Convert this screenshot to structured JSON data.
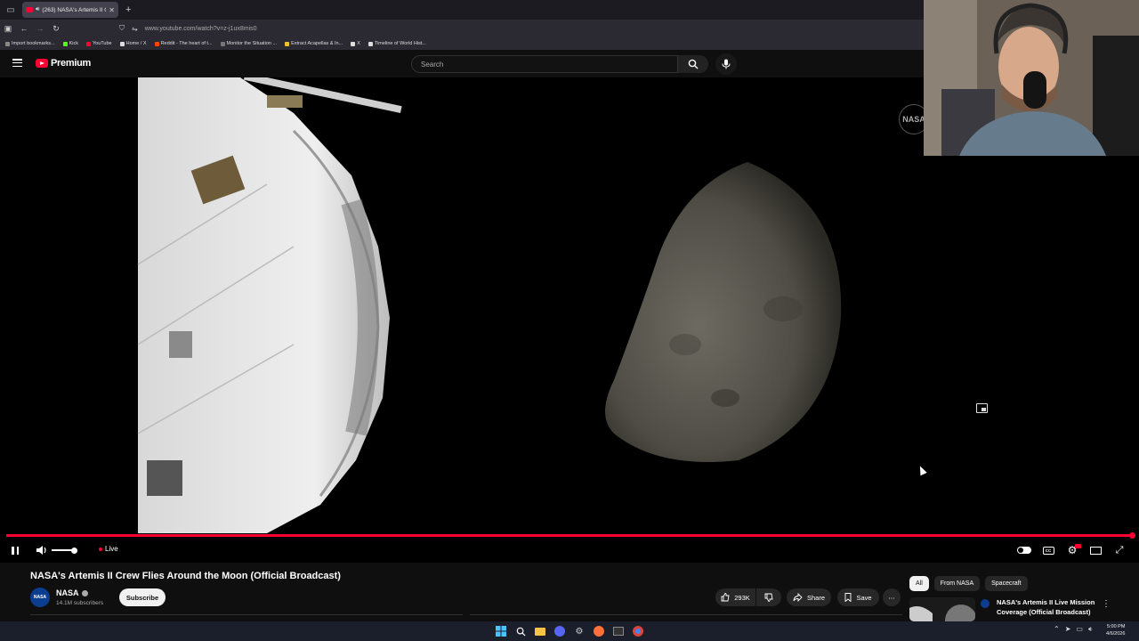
{
  "browser": {
    "tab_title": "(263) NASA's Artemis II Cre",
    "tab_close": "✕",
    "new_tab": "+",
    "url": "www.youtube.com/watch?v=z-j1ux8mis0",
    "bookmarks": [
      {
        "label": "Import bookmarks...",
        "color": "#888888"
      },
      {
        "label": "Kick",
        "color": "#53fc18"
      },
      {
        "label": "YouTube",
        "color": "#ff0033"
      },
      {
        "label": "Home / X",
        "color": "#dddddd"
      },
      {
        "label": "Reddit - The heart of t...",
        "color": "#ff4500"
      },
      {
        "label": "Monitor the Situation ...",
        "color": "#777777"
      },
      {
        "label": "Extract Acapellas & In...",
        "color": "#f2c12e"
      },
      {
        "label": "X",
        "color": "#dddddd"
      },
      {
        "label": "Timeline of World Hist...",
        "color": "#dddddd"
      }
    ]
  },
  "header": {
    "logo_text": "Premium",
    "search_placeholder": "Search"
  },
  "player": {
    "live_label": "Live",
    "watermark": "NASA",
    "progress": 1.0,
    "volume": 0.85,
    "accent_color": "#ff0033"
  },
  "video": {
    "title": "NASA's Artemis II Crew Flies Around the Moon (Official Broadcast)",
    "channel": "NASA",
    "channel_avatar_text": "NASA",
    "subscribers": "14.1M subscribers",
    "subscribe_label": "Subscribe",
    "likes": "293K",
    "share_label": "Share",
    "save_label": "Save"
  },
  "related": {
    "chips": [
      {
        "label": "All",
        "active": true
      },
      {
        "label": "From NASA",
        "active": false
      },
      {
        "label": "Spacecraft",
        "active": false
      }
    ],
    "first_item_title": "NASA's Artemis II Live Mission Coverage (Official Broadcast)"
  },
  "taskbar": {
    "time": "5:00 PM",
    "date": "4/6/2026"
  }
}
